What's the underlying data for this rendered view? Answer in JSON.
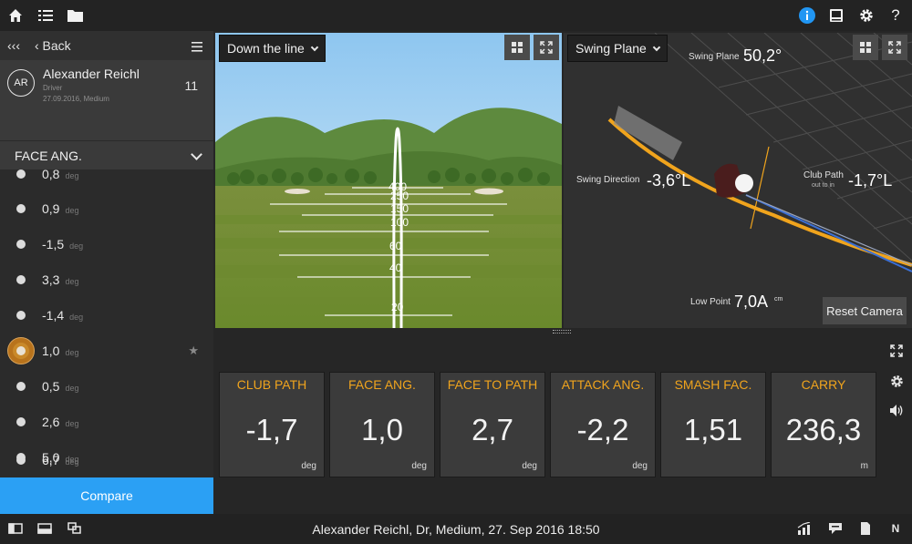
{
  "sidebar": {
    "nav": {
      "collapse_glyph": "‹‹‹",
      "back_label": "‹ Back"
    },
    "user": {
      "initials": "AR",
      "name": "Alexander Reichl",
      "club": "Driver",
      "date": "27.09.2016, Medium",
      "count": "11"
    },
    "metric_selector": "FACE ANG.",
    "shots": [
      {
        "value": "0,8",
        "unit": "deg"
      },
      {
        "value": "0,9",
        "unit": "deg"
      },
      {
        "value": "-1,5",
        "unit": "deg"
      },
      {
        "value": "3,3",
        "unit": "deg"
      },
      {
        "value": "-1,4",
        "unit": "deg"
      },
      {
        "value": "1,0",
        "unit": "deg",
        "selected": true,
        "starred": true
      },
      {
        "value": "0,5",
        "unit": "deg"
      },
      {
        "value": "2,6",
        "unit": "deg"
      },
      {
        "value": "5,0",
        "unit": "deg"
      },
      {
        "value": "6,7",
        "unit": "deg"
      }
    ],
    "compare_label": "Compare"
  },
  "view_left": {
    "dropdown": "Down the line",
    "distance_labels": [
      "400",
      "250",
      "150",
      "100",
      "60",
      "40",
      "20"
    ]
  },
  "view_right": {
    "dropdown": "Swing Plane",
    "swing_plane_label": "Swing Plane",
    "swing_plane_value": "50,2°",
    "swing_direction_label": "Swing Direction",
    "swing_direction_value": "-3,6°L",
    "club_path_label": "Club Path",
    "club_path_sub": "out to in",
    "club_path_value": "-1,7°L",
    "low_point_label": "Low Point",
    "low_point_value": "7,0A",
    "low_point_unit": "cm",
    "reset_label": "Reset Camera"
  },
  "metrics": [
    {
      "label": "CLUB PATH",
      "value": "-1,7",
      "unit": "deg"
    },
    {
      "label": "FACE ANG.",
      "value": "1,0",
      "unit": "deg"
    },
    {
      "label": "FACE TO PATH",
      "value": "2,7",
      "unit": "deg"
    },
    {
      "label": "ATTACK ANG.",
      "value": "-2,2",
      "unit": "deg"
    },
    {
      "label": "SMASH FAC.",
      "value": "1,51",
      "unit": ""
    },
    {
      "label": "CARRY",
      "value": "236,3",
      "unit": "m"
    }
  ],
  "status_text": "Alexander Reichl, Dr, Medium, 27. Sep 2016 18:50",
  "bottom_right_letter": "N",
  "colors": {
    "accent_blue": "#2ba0f4",
    "metric_orange": "#f0a41d",
    "info_blue": "#2196f3"
  }
}
